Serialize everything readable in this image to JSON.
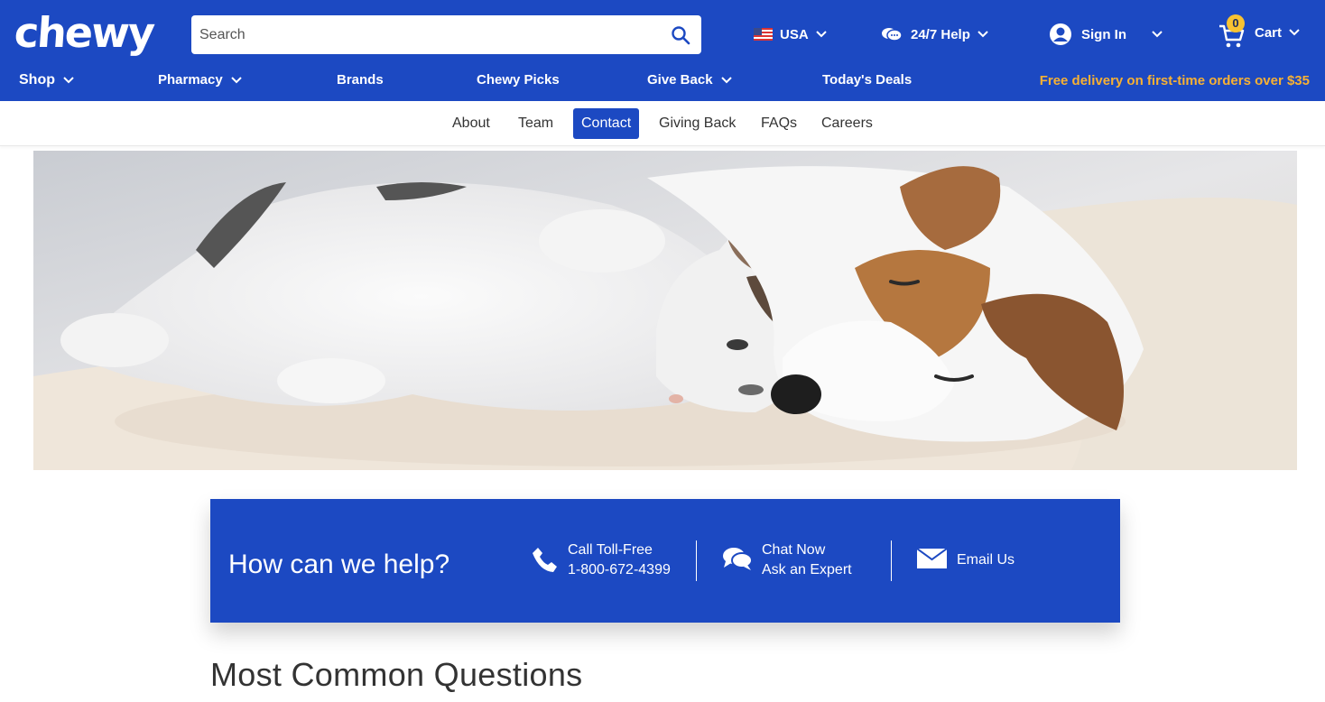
{
  "header": {
    "logo_text": "chewy",
    "search": {
      "placeholder": "Search"
    },
    "country": "USA",
    "help": "24/7 Help",
    "sign_in": "Sign In",
    "cart": {
      "label": "Cart",
      "count": "0"
    }
  },
  "main_nav": [
    {
      "label": "Shop"
    },
    {
      "label": "Pharmacy"
    },
    {
      "label": "Brands"
    },
    {
      "label": "Chewy Picks"
    },
    {
      "label": "Give Back"
    },
    {
      "label": "Today's Deals"
    }
  ],
  "promo": "Free delivery on first-time orders over $35",
  "sub_nav": [
    {
      "label": "About"
    },
    {
      "label": "Team"
    },
    {
      "label": "Contact",
      "active": true
    },
    {
      "label": "Giving Back"
    },
    {
      "label": "FAQs"
    },
    {
      "label": "Careers"
    }
  ],
  "help_box": {
    "title": "How can we help?",
    "call": {
      "line1": "Call Toll-Free",
      "line2": "1-800-672-4399"
    },
    "chat": {
      "line1": "Chat Now",
      "line2": "Ask an Expert"
    },
    "email": {
      "label": "Email Us"
    }
  },
  "section_title": "Most Common Questions",
  "colors": {
    "brand_blue": "#1c49c2",
    "promo_yellow": "#f8b133",
    "cart_badge": "#f8c232"
  },
  "icons": [
    "search-icon",
    "us-flag-icon",
    "chat-help-icon",
    "user-icon",
    "cart-icon",
    "chevron-down-icon",
    "phone-icon",
    "chat-bubbles-icon",
    "envelope-icon"
  ]
}
